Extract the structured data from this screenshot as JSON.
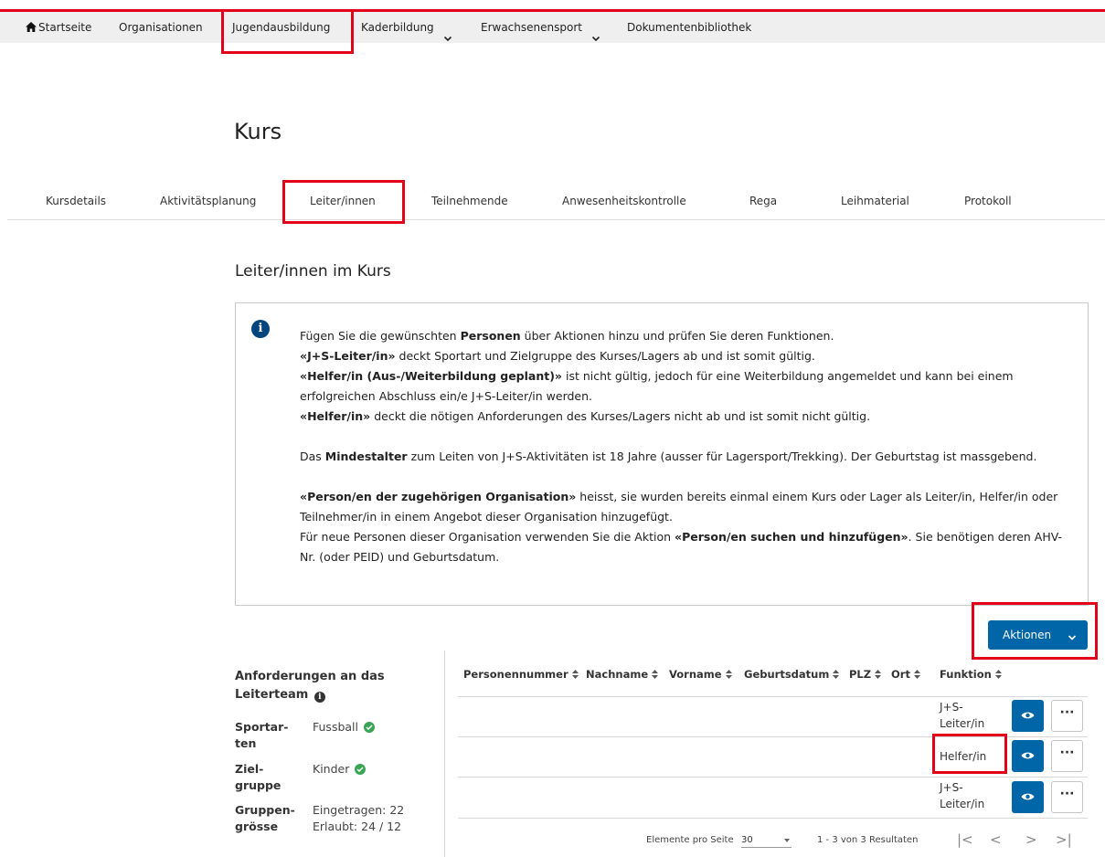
{
  "nav": {
    "items": [
      {
        "label": "Startseite"
      },
      {
        "label": "Organisationen"
      },
      {
        "label": "Jugendausbildung"
      },
      {
        "label": "Kaderbildung"
      },
      {
        "label": "Erwachsenensport"
      },
      {
        "label": "Dokumentenbibliothek"
      }
    ]
  },
  "page": {
    "title": "Kurs"
  },
  "tabs": [
    {
      "label": "Kursdetails"
    },
    {
      "label": "Aktivitätsplanung"
    },
    {
      "label": "Leiter/innen"
    },
    {
      "label": "Teilnehmende"
    },
    {
      "label": "Anwesenheitskontrolle"
    },
    {
      "label": "Rega"
    },
    {
      "label": "Leihmaterial"
    },
    {
      "label": "Protokoll"
    }
  ],
  "section": {
    "title": "Leiter/innen im Kurs"
  },
  "info": {
    "p1_a": "Fügen Sie die gewünschten ",
    "p1_b": "Personen",
    "p1_c": " über Aktionen hinzu und prüfen Sie deren Funktionen.",
    "p2_b": "«J+S-Leiter/in»",
    "p2_c": " deckt Sportart und Zielgruppe des Kurses/Lagers ab und ist somit gültig.",
    "p3_b": "«Helfer/in (Aus-/Weiterbildung geplant)»",
    "p3_c": " ist nicht gültig, jedoch für eine Weiterbildung angemeldet und kann bei einem erfolgreichen Abschluss ein/e J+S-Leiter/in werden.",
    "p4_b": "«Helfer/in»",
    "p4_c": " deckt die nötigen Anforderungen des Kurses/Lagers nicht ab und ist somit nicht gültig.",
    "p5_a": "Das ",
    "p5_b": "Mindestalter",
    "p5_c": " zum Leiten von J+S-Aktivitäten ist 18 Jahre (ausser für Lagersport/Trekking). Der Geburtstag ist massgebend.",
    "p6_b": "«Person/en der zugehörigen Organisation»",
    "p6_c": " heisst, sie wurden bereits einmal einem Kurs oder Lager als Leiter/in, Helfer/in oder Teilnehmer/in in einem Angebot dieser Organisation hinzugefügt.",
    "p7_a": "Für neue Personen dieser Organisation verwenden Sie die Aktion ",
    "p7_b": "«Person/en suchen und hinzufügen»",
    "p7_c": ". Sie benötigen deren AHV-Nr. (oder PEID) und Geburtsdatum."
  },
  "actions": {
    "label": "Aktionen"
  },
  "requirements": {
    "title": "Anforderungen an das Leiterteam",
    "sportarten_label": "Sportar-\nten",
    "sportarten_value": "Fussball",
    "zielgruppe_label": "Ziel-\ngruppe",
    "zielgruppe_value": "Kinder",
    "gruppengroesse_label": "Gruppen-\ngrösse",
    "gruppengroesse_value": "Eingetragen: 22\nErlaubt: 24 / 12"
  },
  "table": {
    "headers": [
      "Personennummer",
      "Nachname",
      "Vorname",
      "Geburtsdatum",
      "PLZ",
      "Ort",
      "Funktion"
    ],
    "rows": [
      {
        "funktion": "J+S-\nLeiter/in"
      },
      {
        "funktion": "Helfer/in"
      },
      {
        "funktion": "J+S-\nLeiter/in"
      }
    ]
  },
  "pagination": {
    "per_page_label": "Elemente pro Seite",
    "per_page_value": "30",
    "results": "1 - 3 von 3 Resultaten",
    "first": "|<",
    "prev": "<",
    "next": ">",
    "last": ">|"
  },
  "colors": {
    "brand_red": "#e2001a",
    "primary_blue": "#0066a8",
    "info_blue": "#00457d",
    "check_green": "#3aa655"
  }
}
